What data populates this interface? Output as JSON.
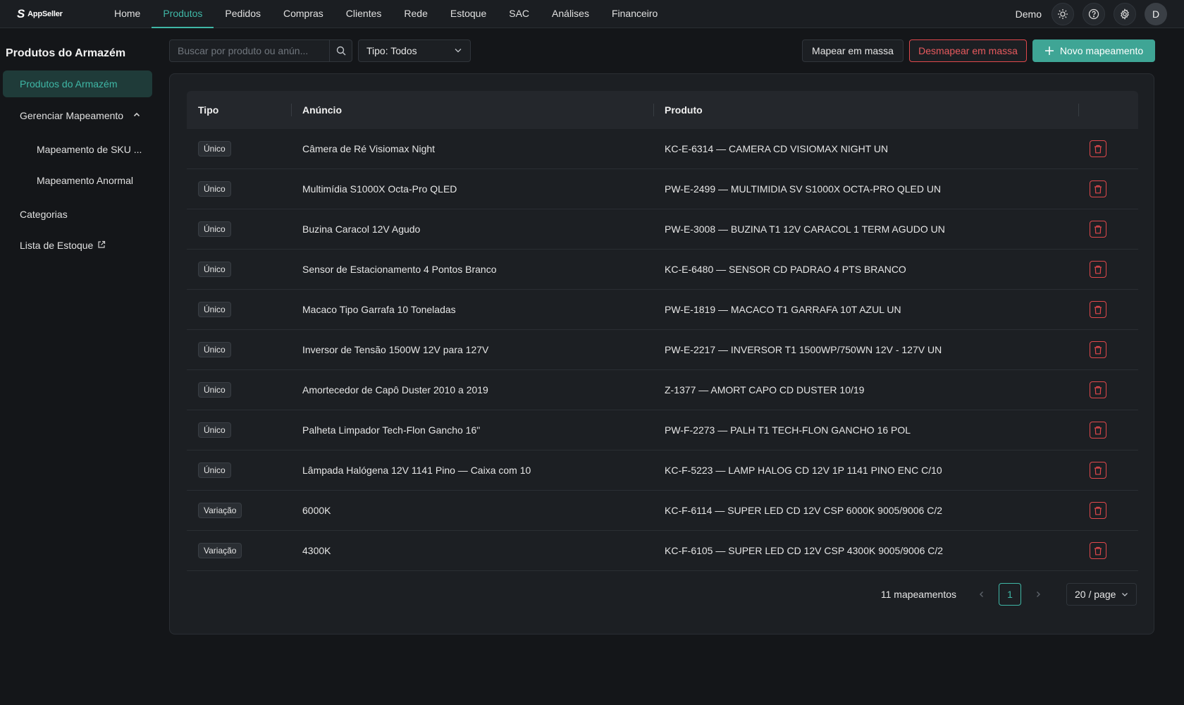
{
  "app": {
    "logo_text": "AppSeller"
  },
  "nav": {
    "items": [
      {
        "label": "Home",
        "active": false
      },
      {
        "label": "Produtos",
        "active": true
      },
      {
        "label": "Pedidos",
        "active": false
      },
      {
        "label": "Compras",
        "active": false
      },
      {
        "label": "Clientes",
        "active": false
      },
      {
        "label": "Rede",
        "active": false
      },
      {
        "label": "Estoque",
        "active": false
      },
      {
        "label": "SAC",
        "active": false
      },
      {
        "label": "Análises",
        "active": false
      },
      {
        "label": "Financeiro",
        "active": false
      }
    ],
    "user_name": "Demo",
    "avatar_initial": "D",
    "icons": [
      "sun-icon",
      "help-icon",
      "gear-icon"
    ]
  },
  "sidebar": {
    "title": "Produtos do Armazém",
    "items": [
      {
        "label": "Produtos do Armazém",
        "active": true
      },
      {
        "label": "Gerenciar Mapeamento",
        "expanded": true
      },
      {
        "label": "Mapeamento de SKU ...",
        "sub": true
      },
      {
        "label": "Mapeamento Anormal",
        "sub": true
      },
      {
        "label": "Categorias"
      },
      {
        "label": "Lista de Estoque",
        "external": true
      }
    ]
  },
  "toolbar": {
    "search_placeholder": "Buscar por produto ou anún...",
    "type_filter": "Tipo: Todos",
    "map_bulk": "Mapear em massa",
    "unmap_bulk": "Desmapear em massa",
    "new_mapping": "Novo mapeamento"
  },
  "table": {
    "headers": {
      "tipo": "Tipo",
      "anuncio": "Anúncio",
      "produto": "Produto"
    },
    "rows": [
      {
        "tipo": "Único",
        "anuncio": "Câmera de Ré Visiomax Night",
        "produto": "KC-E-6314 — CAMERA CD VISIOMAX NIGHT UN"
      },
      {
        "tipo": "Único",
        "anuncio": "Multimídia S1000X Octa-Pro QLED",
        "produto": "PW-E-2499 — MULTIMIDIA SV S1000X OCTA-PRO QLED UN"
      },
      {
        "tipo": "Único",
        "anuncio": "Buzina Caracol 12V Agudo",
        "produto": "PW-E-3008 — BUZINA T1 12V CARACOL 1 TERM AGUDO UN"
      },
      {
        "tipo": "Único",
        "anuncio": "Sensor de Estacionamento 4 Pontos Branco",
        "produto": "KC-E-6480 — SENSOR CD PADRAO 4 PTS BRANCO"
      },
      {
        "tipo": "Único",
        "anuncio": "Macaco Tipo Garrafa 10 Toneladas",
        "produto": "PW-E-1819 — MACACO T1 GARRAFA 10T AZUL UN"
      },
      {
        "tipo": "Único",
        "anuncio": "Inversor de Tensão 1500W 12V para 127V",
        "produto": "PW-E-2217 — INVERSOR T1 1500WP/750WN 12V - 127V UN"
      },
      {
        "tipo": "Único",
        "anuncio": "Amortecedor de Capô Duster 2010 a 2019",
        "produto": "Z-1377 — AMORT CAPO CD DUSTER 10/19"
      },
      {
        "tipo": "Único",
        "anuncio": "Palheta Limpador Tech-Flon Gancho 16\"",
        "produto": "PW-F-2273 — PALH T1 TECH-FLON GANCHO 16 POL"
      },
      {
        "tipo": "Único",
        "anuncio": "Lâmpada Halógena 12V 1141 Pino — Caixa com 10",
        "produto": "KC-F-5223 — LAMP HALOG CD 12V 1P 1141 PINO ENC C/10"
      },
      {
        "tipo": "Variação",
        "anuncio": "6000K",
        "produto": "KC-F-6114 — SUPER LED CD 12V CSP 6000K 9005/9006 C/2"
      },
      {
        "tipo": "Variação",
        "anuncio": "4300K",
        "produto": "KC-F-6105 — SUPER LED CD 12V CSP 4300K 9005/9006 C/2"
      }
    ]
  },
  "pagination": {
    "total": "11 mapeamentos",
    "current_page": "1",
    "page_size": "20 / page"
  },
  "colors": {
    "accent": "#3fb7a6",
    "danger": "#e0484c",
    "background": "#141619",
    "surface": "#1c1f23"
  }
}
